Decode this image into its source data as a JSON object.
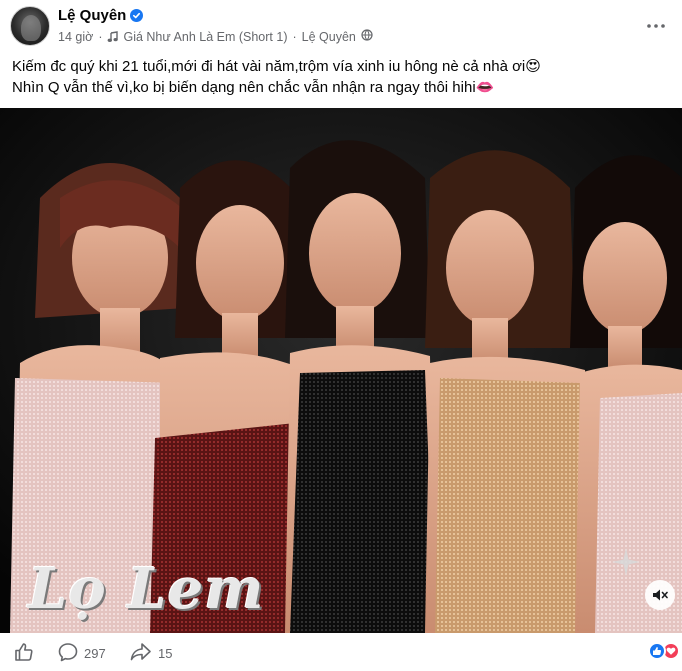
{
  "post": {
    "author": "Lệ Quyên",
    "time": "14 giờ",
    "separator": "·",
    "music": "Giá Như Anh Là Em (Short 1)",
    "music_artist": "Lệ Quyên",
    "caption_line1": "Kiếm đc quý khi 21 tuổi,mới đi hát vài năm,trộm vía xinh iu hông nè cả nhà ơi😍",
    "caption_line2": "Nhìn Q vẫn thế vì,ko bị biến dạng nên chắc vẫn nhận ra ngay thôi hihi👄"
  },
  "media": {
    "overlay_logo": "Lọ Lem"
  },
  "actions": {
    "comment_count": "297",
    "share_count": "15"
  },
  "icons": {
    "verified": "verified-badge-icon",
    "music": "music-note-icon",
    "public": "globe-icon",
    "more": "more-dots-icon",
    "like": "thumbs-up-icon",
    "comment": "comment-bubble-icon",
    "share": "share-arrow-icon",
    "mute": "speaker-muted-icon"
  },
  "colors": {
    "brand_blue": "#1877f2",
    "love_red": "#f33e58",
    "meta_gray": "#65676b"
  }
}
